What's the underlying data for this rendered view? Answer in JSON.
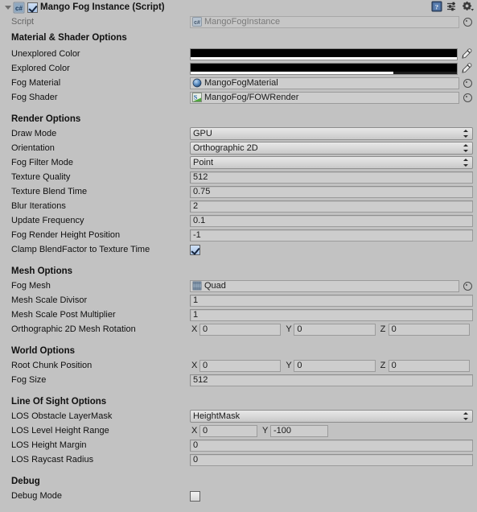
{
  "header": {
    "title": "Mango Fog Instance (Script)",
    "enabled_checkbox": true,
    "script_icon": "csharp-script-icon",
    "icons": [
      "help-book-icon",
      "preset-icon",
      "gear-dropdown-icon"
    ]
  },
  "script_row": {
    "label": "Script",
    "value": "MangoFogInstance",
    "icon": "csharp-script-icon",
    "disabled": true
  },
  "sections": [
    {
      "title": "Material & Shader Options",
      "rows": [
        {
          "type": "color",
          "label": "Unexplored Color",
          "color": "#000000",
          "alpha": 1.0
        },
        {
          "type": "color",
          "label": "Explored Color",
          "color": "#000000",
          "alpha": 0.76
        },
        {
          "type": "object",
          "label": "Fog Material",
          "value": "MangoFogMaterial",
          "icon": "material-sphere-icon"
        },
        {
          "type": "object",
          "label": "Fog Shader",
          "value": "MangoFog/FOWRender",
          "icon": "shader-icon"
        }
      ]
    },
    {
      "title": "Render Options",
      "rows": [
        {
          "type": "popup",
          "label": "Draw Mode",
          "value": "GPU"
        },
        {
          "type": "popup",
          "label": "Orientation",
          "value": "Orthographic 2D"
        },
        {
          "type": "popup",
          "label": "Fog Filter Mode",
          "value": "Point"
        },
        {
          "type": "text",
          "label": "Texture Quality",
          "value": "512"
        },
        {
          "type": "text",
          "label": "Texture Blend Time",
          "value": "0.75"
        },
        {
          "type": "text",
          "label": "Blur Iterations",
          "value": "2"
        },
        {
          "type": "text",
          "label": "Update Frequency",
          "value": "0.1"
        },
        {
          "type": "text",
          "label": "Fog Render Height Position",
          "value": "-1"
        },
        {
          "type": "checkbox",
          "label": "Clamp BlendFactor to Texture Time",
          "checked": true
        }
      ]
    },
    {
      "title": "Mesh Options",
      "rows": [
        {
          "type": "object",
          "label": "Fog Mesh",
          "value": "Quad",
          "icon": "mesh-icon"
        },
        {
          "type": "text",
          "label": "Mesh Scale Divisor",
          "value": "1"
        },
        {
          "type": "text",
          "label": "Mesh Scale Post Multiplier",
          "value": "1"
        },
        {
          "type": "vector3",
          "label": "Orthographic 2D Mesh Rotation",
          "axes": [
            {
              "name": "X",
              "value": "0"
            },
            {
              "name": "Y",
              "value": "0"
            },
            {
              "name": "Z",
              "value": "0"
            }
          ]
        }
      ]
    },
    {
      "title": "World Options",
      "rows": [
        {
          "type": "vector3",
          "label": "Root Chunk Position",
          "axes": [
            {
              "name": "X",
              "value": "0"
            },
            {
              "name": "Y",
              "value": "0"
            },
            {
              "name": "Z",
              "value": "0"
            }
          ]
        },
        {
          "type": "text",
          "label": "Fog Size",
          "value": "512"
        }
      ]
    },
    {
      "title": "Line Of Sight Options",
      "rows": [
        {
          "type": "popup",
          "label": "LOS Obstacle LayerMask",
          "value": "HeightMask"
        },
        {
          "type": "vector2",
          "label": "LOS Level Height Range",
          "axes": [
            {
              "name": "X",
              "value": "0"
            },
            {
              "name": "Y",
              "value": "-100"
            }
          ]
        },
        {
          "type": "text",
          "label": "LOS Height Margin",
          "value": "0"
        },
        {
          "type": "text",
          "label": "LOS Raycast Radius",
          "value": "0"
        }
      ]
    },
    {
      "title": "Debug",
      "rows": [
        {
          "type": "checkbox",
          "label": "Debug Mode",
          "checked": false
        }
      ]
    }
  ],
  "colors": {
    "background": "#c2c2c2",
    "field_bg": "#cdcdcd",
    "field_border": "#9b9b9b",
    "text": "#1a1a1a",
    "disabled_text": "#7a7a7a",
    "checkbox_accent": "#a9c4e8"
  }
}
